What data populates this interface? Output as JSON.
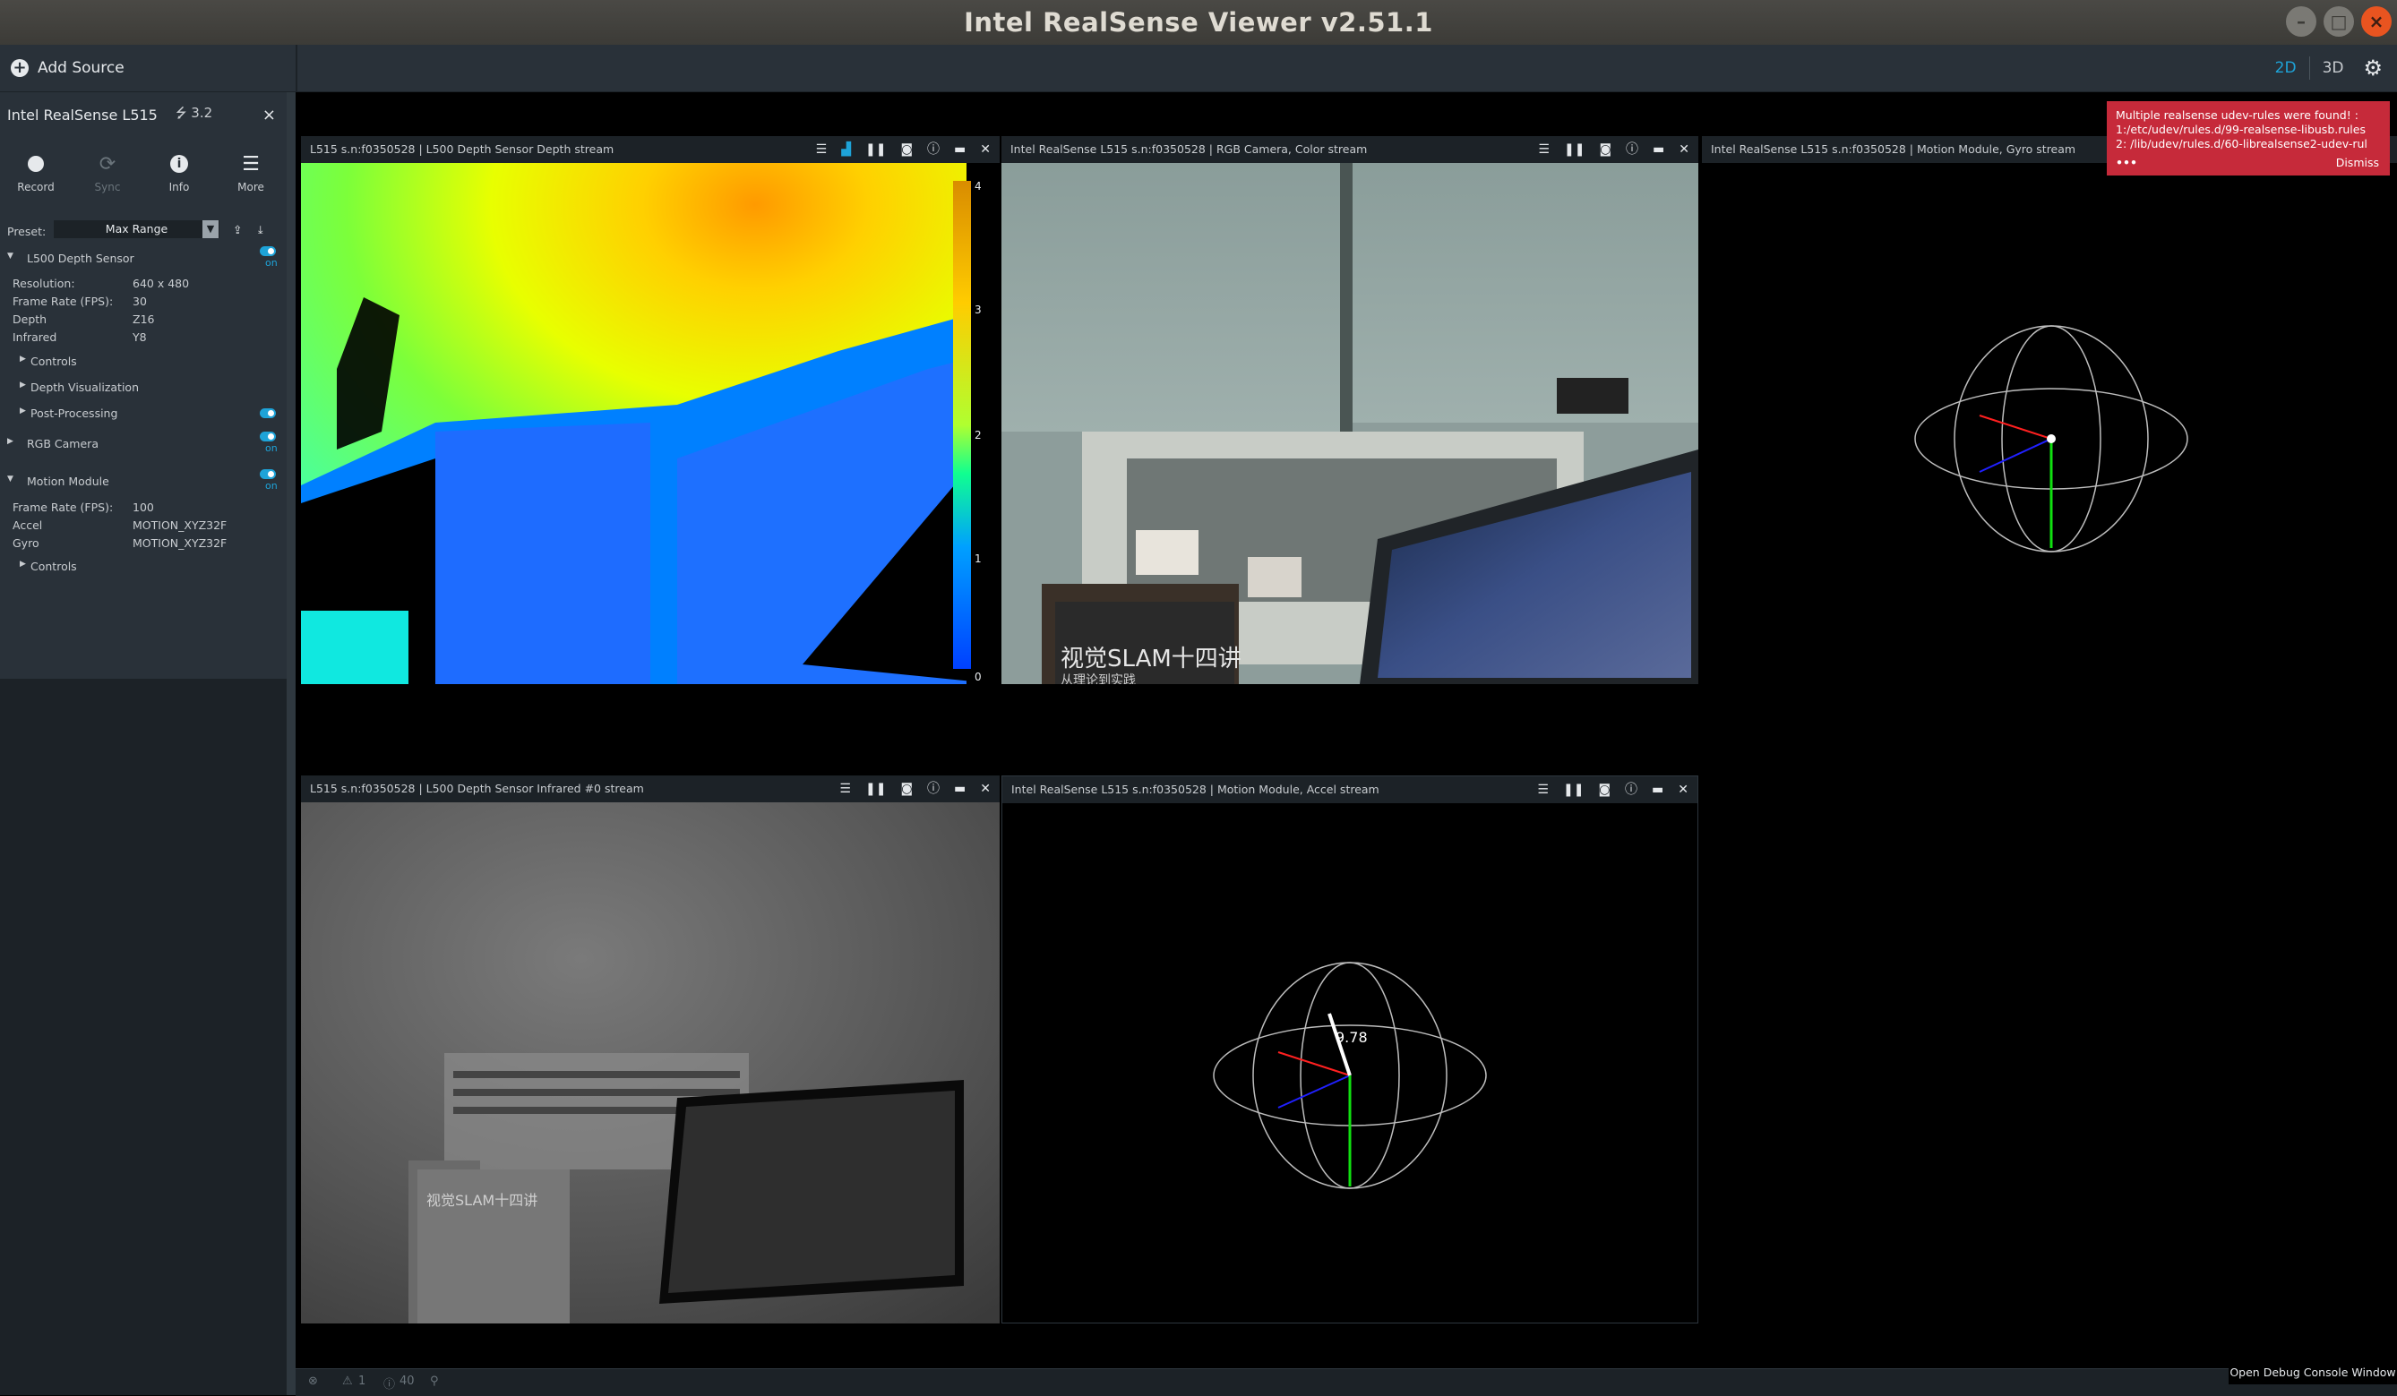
{
  "window": {
    "title": "Intel RealSense Viewer v2.51.1"
  },
  "toolbar": {
    "add_source": "Add Source",
    "mode_2d": "2D",
    "mode_3d": "3D"
  },
  "device": {
    "name": "Intel RealSense L515",
    "usb": "3.2",
    "close": "×",
    "tools": [
      {
        "label": "Record",
        "icon": "record-icon"
      },
      {
        "label": "Sync",
        "icon": "sync-icon"
      },
      {
        "label": "Info",
        "icon": "info-icon"
      },
      {
        "label": "More",
        "icon": "menu-icon"
      }
    ],
    "preset_label": "Preset:",
    "preset_value": "Max Range",
    "on_label": "on"
  },
  "sensors": {
    "depth": {
      "name": "L500 Depth Sensor",
      "props": [
        {
          "k": "Resolution:",
          "v": "640 x 480"
        },
        {
          "k": "Frame Rate (FPS):",
          "v": "30"
        },
        {
          "k": "Depth",
          "v": "Z16"
        },
        {
          "k": "Infrared",
          "v": "Y8"
        }
      ],
      "controls": "Controls",
      "depth_vis": "Depth Visualization",
      "post": "Post-Processing"
    },
    "rgb": {
      "name": "RGB Camera"
    },
    "motion": {
      "name": "Motion Module",
      "props": [
        {
          "k": "Frame Rate (FPS):",
          "v": "100"
        },
        {
          "k": "Accel",
          "v": "MOTION_XYZ32F"
        },
        {
          "k": "Gyro",
          "v": "MOTION_XYZ32F"
        }
      ],
      "controls": "Controls"
    }
  },
  "streams": {
    "depth": "L515 s.n:f0350528 | L500 Depth Sensor Depth stream",
    "color": "Intel RealSense L515 s.n:f0350528 | RGB Camera, Color stream",
    "gyro": "Intel RealSense L515 s.n:f0350528 | Motion Module, Gyro stream",
    "infrared": "L515 s.n:f0350528 | L500 Depth Sensor Infrared #0 stream",
    "accel": "Intel RealSense L515 s.n:f0350528 | Motion Module, Accel stream"
  },
  "depth_scale": [
    "4",
    "3",
    "2",
    "1",
    "0"
  ],
  "color_scene": {
    "book_text": "视觉SLAM十四讲",
    "book_sub": "从理论到实践"
  },
  "ir_scene": {
    "book_text": "视觉SLAM十四讲"
  },
  "accel_label": "9.78",
  "notification": {
    "line1": "Multiple realsense udev-rules were found! :",
    "line2": "1:/etc/udev/rules.d/99-realsense-libusb.rules",
    "line3": "2: /lib/udev/rules.d/60-librealsense2-udev-rul",
    "dots": "•••",
    "dismiss": "Dismiss"
  },
  "status": {
    "warnings": "1",
    "info": "40"
  },
  "debug_button": "Open Debug Console Window",
  "colors": {
    "accent": "#1ea3d8",
    "notification": "#c62a3a"
  }
}
